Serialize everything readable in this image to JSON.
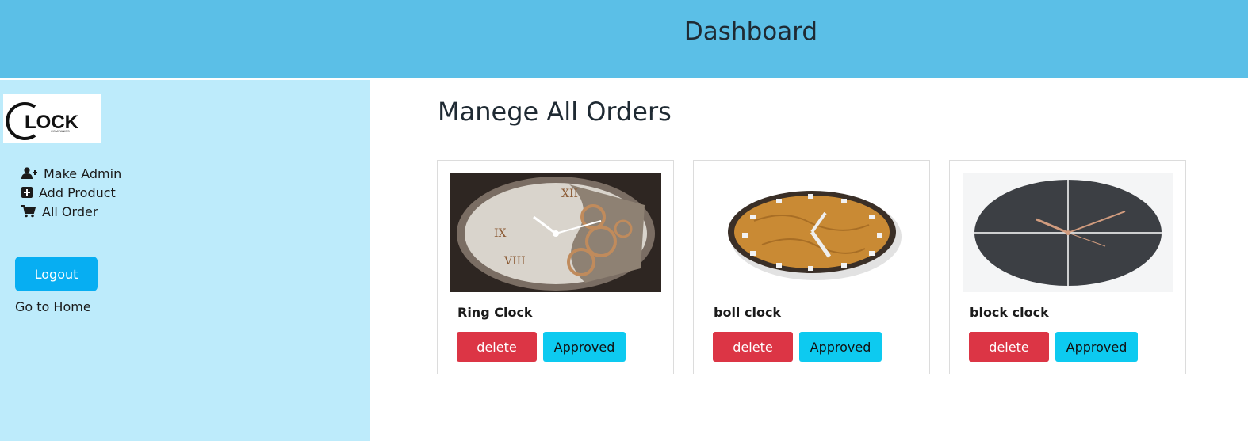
{
  "header": {
    "title": "Dashboard"
  },
  "sidebar": {
    "logo_text": "LOCK",
    "logo_sub": "COMPANIES",
    "items": [
      {
        "label": "Make Admin",
        "icon": "user-plus-icon"
      },
      {
        "label": "Add Product",
        "icon": "plus-square-icon"
      },
      {
        "label": "All Order",
        "icon": "cart-icon"
      }
    ],
    "logout_label": "Logout",
    "home_label": "Go to Home"
  },
  "main": {
    "title": "Manege All Orders",
    "orders": [
      {
        "name": "Ring Clock",
        "delete_label": "delete",
        "approve_label": "Approved"
      },
      {
        "name": "boll clock",
        "delete_label": "delete",
        "approve_label": "Approved"
      },
      {
        "name": "block clock",
        "delete_label": "delete",
        "approve_label": "Approved"
      }
    ]
  },
  "colors": {
    "header": "#5bbfe7",
    "sidebar": "#bdebfb",
    "logout": "#07aef2",
    "delete": "#dc3545",
    "approved": "#0dcaf0"
  }
}
